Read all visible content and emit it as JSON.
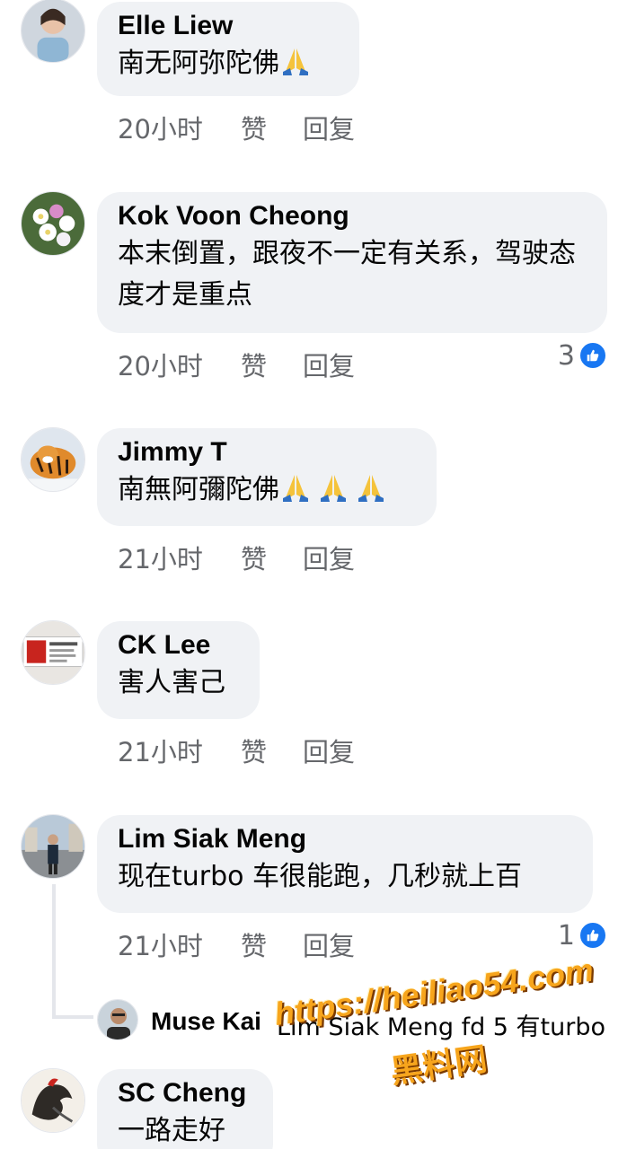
{
  "comments": [
    {
      "name": "Elle Liew",
      "text": "南无阿弥陀佛",
      "emoji_count": 1,
      "time": "20小时",
      "like": "赞",
      "reply": "回复",
      "reactions": ""
    },
    {
      "name": "Kok Voon Cheong",
      "text": "本末倒置，跟夜不一定有关系，驾驶态度才是重点",
      "emoji_count": 0,
      "time": "20小时",
      "like": "赞",
      "reply": "回复",
      "reactions": "3"
    },
    {
      "name": "Jimmy T",
      "text": "南無阿彌陀佛",
      "emoji_count": 3,
      "time": "21小时",
      "like": "赞",
      "reply": "回复",
      "reactions": ""
    },
    {
      "name": "CK Lee",
      "text": "害人害己",
      "emoji_count": 0,
      "time": "21小时",
      "like": "赞",
      "reply": "回复",
      "reactions": ""
    },
    {
      "name": "Lim Siak Meng",
      "text": "现在turbo 车很能跑，几秒就上百",
      "emoji_count": 0,
      "time": "21小时",
      "like": "赞",
      "reply": "回复",
      "reactions": "1"
    },
    {
      "name": "SC Cheng",
      "text": "一路走好",
      "emoji_count": 0,
      "time": "",
      "like": "",
      "reply": "",
      "reactions": ""
    }
  ],
  "reply_preview": {
    "name": "Muse Kai",
    "text": "Lim Siak Meng fd 5 有turbo"
  },
  "watermark": {
    "url": "https://heiliao54.com",
    "label": "黑料网"
  },
  "colors": {
    "bubble": "#f0f2f5",
    "meta_text": "#65676b",
    "like_blue": "#1877f2",
    "watermark": "#f7a51c"
  },
  "icons": {
    "reaction": "like-icon",
    "emoji": "folded-hands-icon"
  }
}
